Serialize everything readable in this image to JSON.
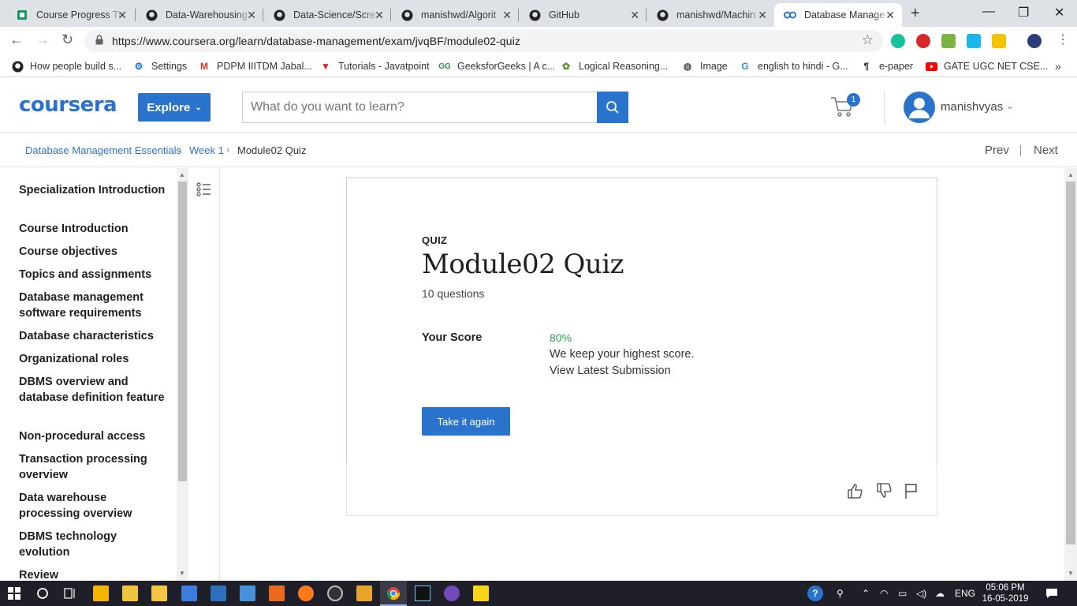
{
  "browser": {
    "tabs": [
      {
        "title": "Course Progress Tr",
        "icon": "sheets-icon"
      },
      {
        "title": "Data-Warehousing",
        "icon": "github-icon"
      },
      {
        "title": "Data-Science/Scre",
        "icon": "github-icon"
      },
      {
        "title": "manishwd/Algorit",
        "icon": "github-icon"
      },
      {
        "title": "GitHub",
        "icon": "github-icon"
      },
      {
        "title": "manishwd/Machin",
        "icon": "github-icon"
      },
      {
        "title": "Database Manage",
        "icon": "coursera-icon",
        "active": true
      }
    ],
    "url": "https://www.coursera.org/learn/database-management/exam/jvqBF/module02-quiz",
    "bookmarks": [
      {
        "label": "How people build s...",
        "icon": "github-icon"
      },
      {
        "label": "Settings",
        "icon": "gear-icon"
      },
      {
        "label": "PDPM IIITDM Jabal...",
        "icon": "gmail-icon"
      },
      {
        "label": "Tutorials - Javatpoint",
        "icon": "javatpoint-icon"
      },
      {
        "label": "GeeksforGeeks | A c...",
        "icon": "geeksforgeeks-icon"
      },
      {
        "label": "Logical Reasoning...",
        "icon": "leaf-icon"
      },
      {
        "label": "Image",
        "icon": "globe-icon"
      },
      {
        "label": "english to hindi - G...",
        "icon": "google-icon"
      },
      {
        "label": "e-paper",
        "icon": "epaper-icon"
      },
      {
        "label": "GATE UGC NET CSE...",
        "icon": "youtube-icon"
      }
    ]
  },
  "header": {
    "logo": "coursera",
    "explore_label": "Explore",
    "search_placeholder": "What do you want to learn?",
    "cart_count": "1",
    "username": "manishvyas"
  },
  "breadcrumb": {
    "items": [
      "Database Management Essentials",
      "Week 1",
      "Module02 Quiz"
    ],
    "prev": "Prev",
    "next": "Next"
  },
  "sidebar": {
    "items": [
      "Specialization Introduction",
      "Course Introduction",
      "Course objectives",
      "Topics and assignments",
      "Database management software requirements",
      "Database characteristics",
      "Organizational roles",
      "DBMS overview and database definition feature",
      "Non-procedural access",
      "Transaction processing overview",
      "Data warehouse processing overview",
      "DBMS technology evolution",
      "Review"
    ]
  },
  "quiz": {
    "label": "QUIZ",
    "title": "Module02 Quiz",
    "count": "10 questions",
    "score_label": "Your Score",
    "score_value": "80%",
    "score_note": "We keep your highest score.",
    "view_latest": "View Latest Submission",
    "retake_label": "Take it again"
  },
  "taskbar": {
    "language": "ENG",
    "time": "05:06 PM",
    "date": "16-05-2019"
  },
  "colors": {
    "brand": "#2a73cc",
    "score_green": "#2e9a4c",
    "taskbar": "#1f1f2a"
  }
}
